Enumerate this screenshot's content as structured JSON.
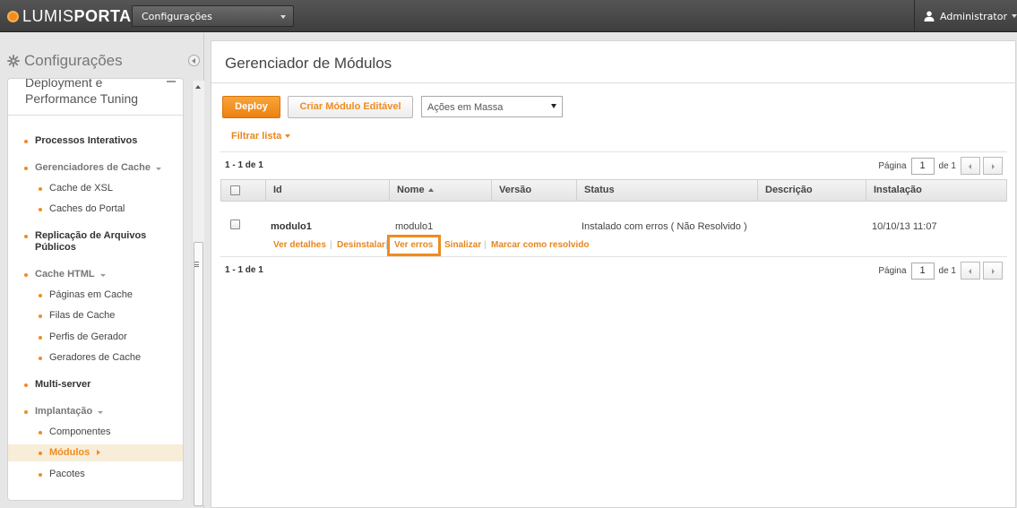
{
  "topbar": {
    "logo_text": "LUMISPORTAL",
    "logo_light": "LUMIS",
    "logo_bold": "PORTAL",
    "context_select": "Configurações",
    "user_name": "Administrator"
  },
  "sidebar": {
    "header": "Configurações",
    "partial_item": "Deployment e Performance Tuning",
    "items": [
      {
        "label": "Processos Interativos",
        "level": 1
      },
      {
        "label": "Gerenciadores de Cache",
        "level": 1,
        "expandable": true
      },
      {
        "label": "Cache de XSL",
        "level": 2
      },
      {
        "label": "Caches do Portal",
        "level": 2
      },
      {
        "label": "Replicação de Arquivos Públicos",
        "level": 1
      },
      {
        "label": "Cache HTML",
        "level": 1,
        "expandable": true
      },
      {
        "label": "Páginas em Cache",
        "level": 2
      },
      {
        "label": "Filas de Cache",
        "level": 2
      },
      {
        "label": "Perfis de Gerador",
        "level": 2
      },
      {
        "label": "Geradores de Cache",
        "level": 2
      },
      {
        "label": "Multi-server",
        "level": 1
      },
      {
        "label": "Implantação",
        "level": 1,
        "expandable": true
      },
      {
        "label": "Componentes",
        "level": 2
      },
      {
        "label": "Módulos",
        "level": 2,
        "active": true
      },
      {
        "label": "Pacotes",
        "level": 2
      }
    ]
  },
  "main": {
    "title": "Gerenciador de Módulos",
    "toolbar": {
      "deploy_label": "Deploy",
      "create_label": "Criar Módulo Editável",
      "mass_actions": "Ações em Massa"
    },
    "filter_label": "Filtrar lista",
    "count_text": "1 - 1 de 1",
    "pager": {
      "page_label": "Página",
      "page_value": "1",
      "of_label": "de 1"
    },
    "columns": [
      "Id",
      "Nome",
      "Versão",
      "Status",
      "Descrição",
      "Instalação"
    ],
    "rows": [
      {
        "id": "modulo1",
        "name": "modulo1",
        "version": "",
        "status": "Instalado com erros ( Não Resolvido )",
        "description": "",
        "installed": "10/10/13 11:07",
        "actions": [
          "Ver detalhes",
          "Desinstalar",
          "Ver erros",
          "Sinalizar",
          "Marcar como resolvido"
        ]
      }
    ]
  },
  "colors": {
    "accent": "#f08c1e",
    "topbar": "#4a4a4a",
    "active_bg": "#f7edd9"
  }
}
